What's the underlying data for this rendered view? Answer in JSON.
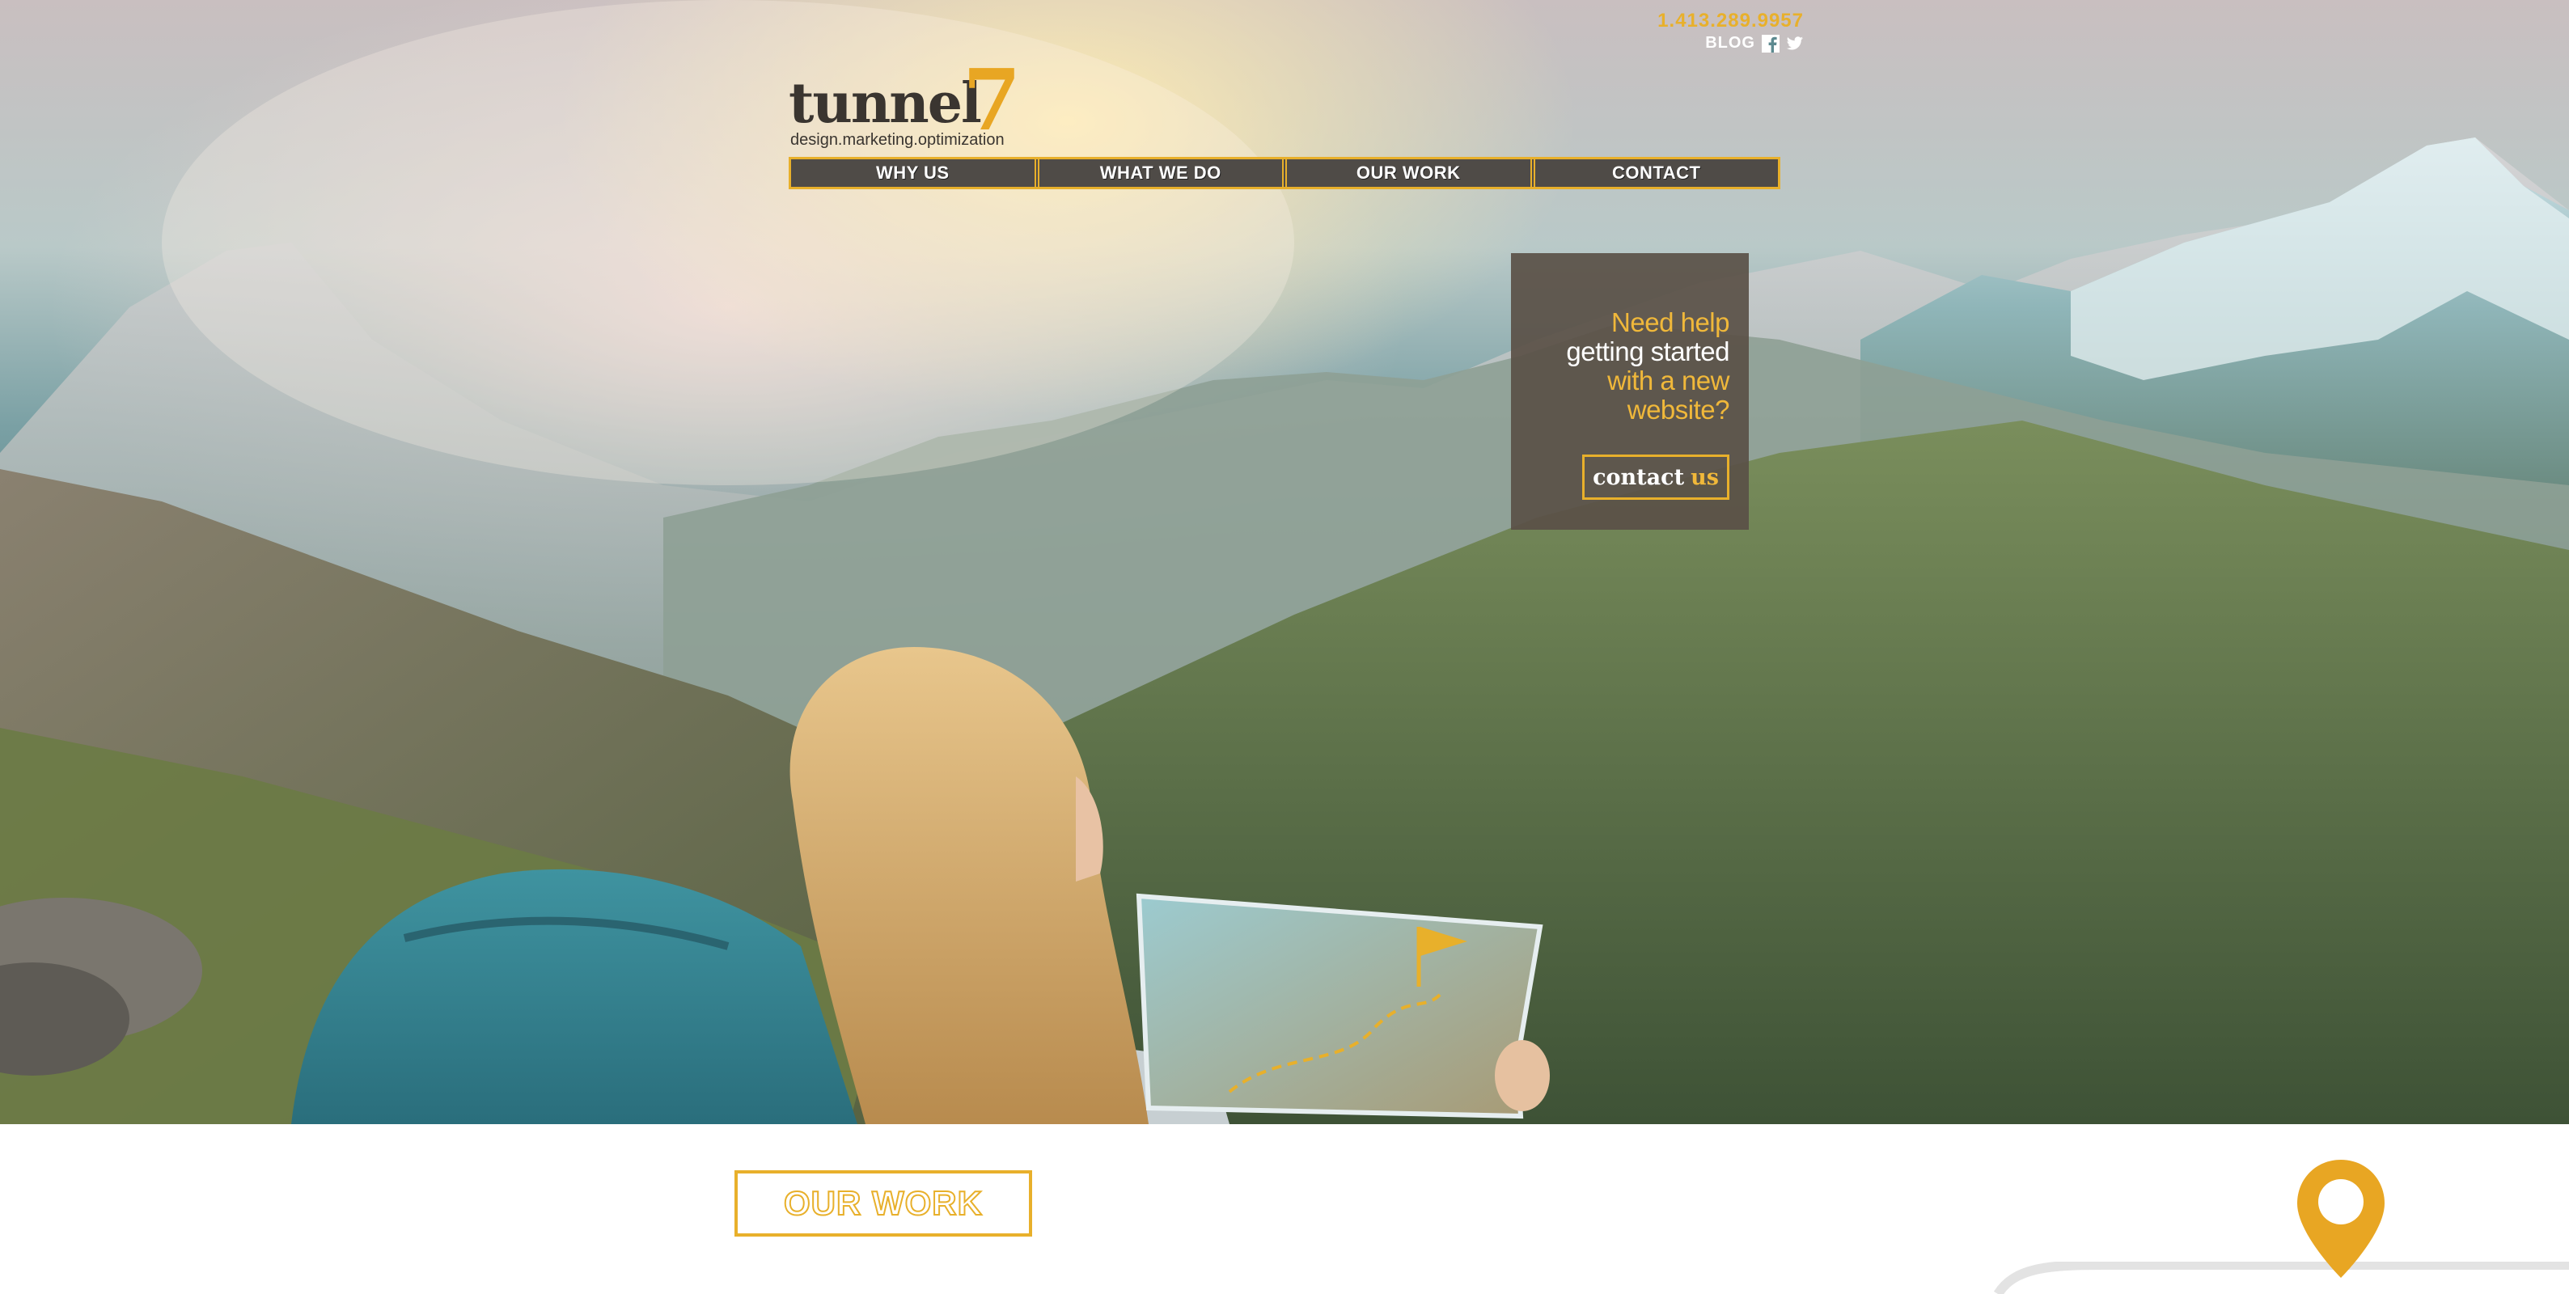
{
  "header": {
    "phone": "1.413.289.9957",
    "blog_label": "BLOG",
    "social": [
      {
        "name": "facebook-icon"
      },
      {
        "name": "twitter-icon"
      }
    ]
  },
  "logo": {
    "word": "tunnel",
    "numeral": "7",
    "tagline": "design.marketing.optimization",
    "accent_color": "#e8a623"
  },
  "nav": {
    "items": [
      {
        "label": "WHY US"
      },
      {
        "label": "WHAT WE DO"
      },
      {
        "label": "OUR WORK"
      },
      {
        "label": "CONTACT"
      }
    ]
  },
  "callout": {
    "lines": [
      "Need help",
      "getting started",
      "with a new",
      "website?"
    ],
    "button": {
      "first": "contact",
      "second": "us"
    }
  },
  "section": {
    "our_work_label": "OUR WORK"
  },
  "colors": {
    "accent": "#e8b02b",
    "dark": "#4f4b47",
    "white": "#ffffff"
  }
}
